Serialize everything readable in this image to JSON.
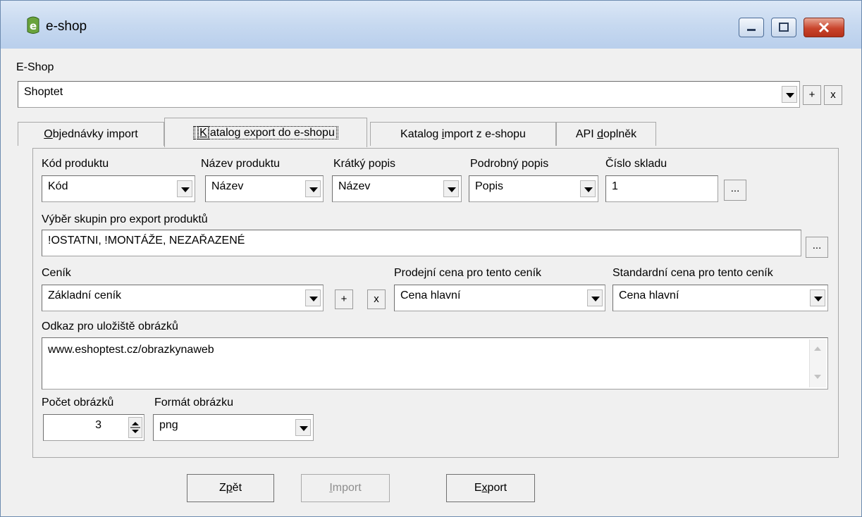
{
  "window": {
    "title": "e-shop",
    "icons": {
      "app": "app-icon",
      "minimize": "minimize-icon",
      "maximize": "maximize-icon",
      "close": "close-icon"
    }
  },
  "eshop": {
    "label": "E-Shop",
    "selected": "Shoptet",
    "add_label": "+",
    "remove_label": "x"
  },
  "tabs": [
    {
      "pre": "",
      "hot": "O",
      "post": "bjednávky import"
    },
    {
      "pre": "",
      "hot": "K",
      "post": "atalog export do e-shopu"
    },
    {
      "pre": "Katalog ",
      "hot": "i",
      "post": "mport z e-shopu"
    },
    {
      "pre": "API ",
      "hot": "d",
      "post": "oplněk"
    }
  ],
  "panel": {
    "kod_produktu": {
      "label": "Kód produktu",
      "value": "Kód"
    },
    "nazev_produktu": {
      "label": "Název produktu",
      "value": "Název"
    },
    "kratky_popis": {
      "label": "Krátký popis",
      "value": "Název"
    },
    "podrobny_popis": {
      "label": "Podrobný popis",
      "value": "Popis"
    },
    "cislo_skladu": {
      "label": "Číslo skladu",
      "value": "1",
      "browse_label": "..."
    },
    "skupiny": {
      "label": "Výběr skupin pro export produktů",
      "value": "!OSTATNI, !MONTÁŽE, NEZAŘAZENÉ",
      "browse_label": "..."
    },
    "cenik": {
      "label": "Ceník",
      "value": "Základní ceník",
      "add_label": "+",
      "remove_label": "x"
    },
    "prodejni_cena": {
      "label": "Prodejní cena pro tento ceník",
      "value": "Cena hlavní"
    },
    "standardni_cena": {
      "label": "Standardní cena pro tento ceník",
      "value": "Cena hlavní"
    },
    "odkaz": {
      "label": "Odkaz pro uložiště obrázků",
      "value": "www.eshoptest.cz/obrazkynaweb"
    },
    "pocet_obrazku": {
      "label": "Počet obrázků",
      "value": "3"
    },
    "format_obrazku": {
      "label": "Formát obrázku",
      "value": "png"
    }
  },
  "buttons": {
    "zpet": {
      "pre": "Z",
      "hot": "p",
      "post": "ět"
    },
    "import": {
      "pre": "",
      "hot": "I",
      "post": "mport"
    },
    "export": {
      "pre": "E",
      "hot": "x",
      "post": "port"
    }
  }
}
